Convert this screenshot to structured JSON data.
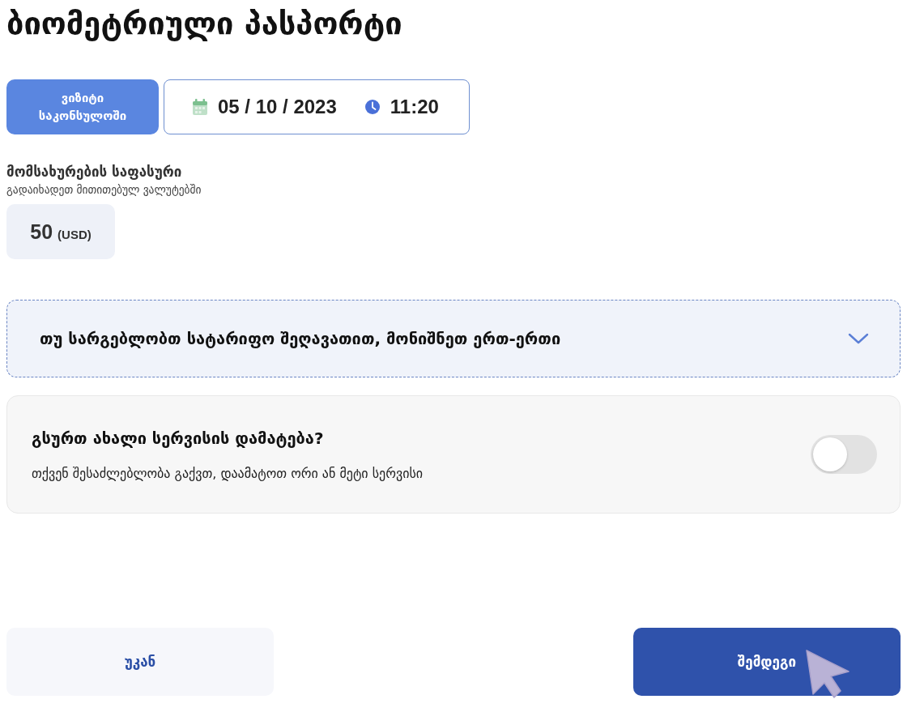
{
  "title": "ბიომეტრიული პასპორტი",
  "visit": {
    "label": "ვიზიტი საკონსულოში",
    "date": "05 / 10 / 2023",
    "time": "11:20"
  },
  "fee": {
    "title": "მომსახურების საფასური",
    "subtitle": "გადაიხადეთ მითითებულ ვალუტებში",
    "amount": "50",
    "currency": "(USD)"
  },
  "discount_dropdown": {
    "label": "თუ სარგებლობთ სატარიფო შეღავათით, მონიშნეთ ერთ-ერთი",
    "expanded": false
  },
  "add_service": {
    "title": "გსურთ ახალი სერვისის დამატება?",
    "description": "თქვენ შესაძლებლობა გაქვთ, დაამატოთ ორი ან მეტი სერვისი",
    "on": false
  },
  "buttons": [
    {
      "label": "უკან",
      "kind": "secondary"
    },
    {
      "label": "შემდეგი",
      "kind": "primary"
    }
  ]
}
